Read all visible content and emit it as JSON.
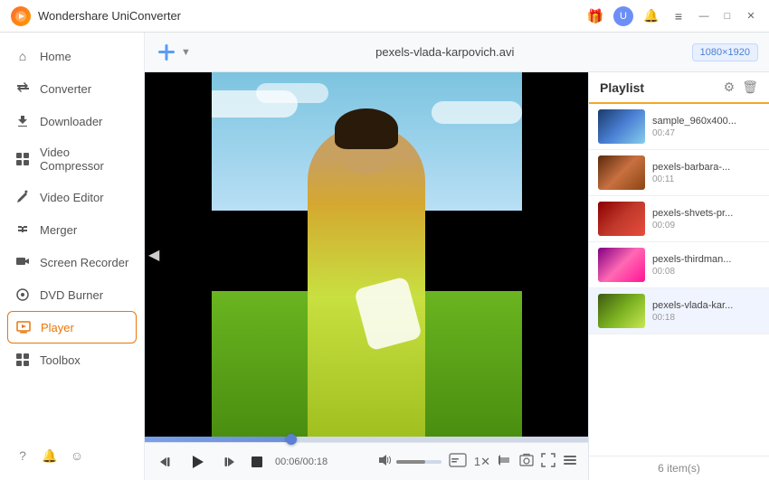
{
  "titleBar": {
    "title": "Wondershare UniConverter",
    "logo": "U"
  },
  "sidebar": {
    "items": [
      {
        "id": "home",
        "label": "Home",
        "icon": "⌂"
      },
      {
        "id": "converter",
        "label": "Converter",
        "icon": "↔"
      },
      {
        "id": "downloader",
        "label": "Downloader",
        "icon": "↓"
      },
      {
        "id": "video-compressor",
        "label": "Video Compressor",
        "icon": "⊡"
      },
      {
        "id": "video-editor",
        "label": "Video Editor",
        "icon": "✂"
      },
      {
        "id": "merger",
        "label": "Merger",
        "icon": "⊕"
      },
      {
        "id": "screen-recorder",
        "label": "Screen Recorder",
        "icon": "⊙"
      },
      {
        "id": "dvd-burner",
        "label": "DVD Burner",
        "icon": "⊚"
      },
      {
        "id": "player",
        "label": "Player",
        "icon": "▷"
      },
      {
        "id": "toolbox",
        "label": "Toolbox",
        "icon": "⊞"
      }
    ],
    "footer": {
      "help": "?",
      "bell": "🔔",
      "feedback": "☺"
    }
  },
  "toolbar": {
    "addLabel": "+",
    "filename": "pexels-vlada-karpovich.avi",
    "resolution": "1080×1920"
  },
  "player": {
    "timeDisplay": "00:06/00:18",
    "progressPercent": 33
  },
  "playlist": {
    "title": "Playlist",
    "itemCount": "6 item(s)",
    "items": [
      {
        "id": 1,
        "name": "sample_960x400...",
        "duration": "00:47",
        "thumbClass": "thumb-1"
      },
      {
        "id": 2,
        "name": "pexels-barbara-...",
        "duration": "00:11",
        "thumbClass": "thumb-2"
      },
      {
        "id": 3,
        "name": "pexels-shvets-pr...",
        "duration": "00:09",
        "thumbClass": "thumb-3"
      },
      {
        "id": 4,
        "name": "pexels-thirdman...",
        "duration": "00:08",
        "thumbClass": "thumb-4"
      },
      {
        "id": 5,
        "name": "pexels-vlada-kar...",
        "duration": "00:18",
        "thumbClass": "thumb-5"
      }
    ]
  }
}
